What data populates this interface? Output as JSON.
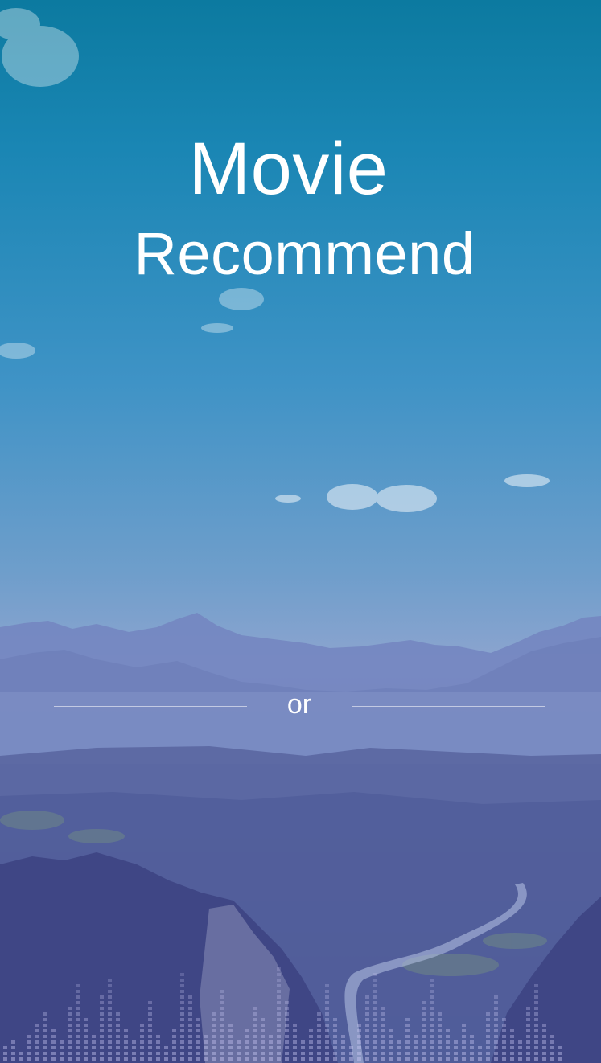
{
  "app": {
    "title_line1": "Movie",
    "title_line2": "Recommend"
  },
  "divider": {
    "text": "or"
  },
  "colors": {
    "sky_top": "#0c7aa0",
    "sky_mid": "#3f93c6",
    "haze": "#8ba4cf",
    "mountain_dark": "#3f4685",
    "equalizer": "#c9c7f2"
  },
  "decor": {
    "background": "mountain-landscape-image",
    "equalizer": "audio-equalizer-bars"
  }
}
